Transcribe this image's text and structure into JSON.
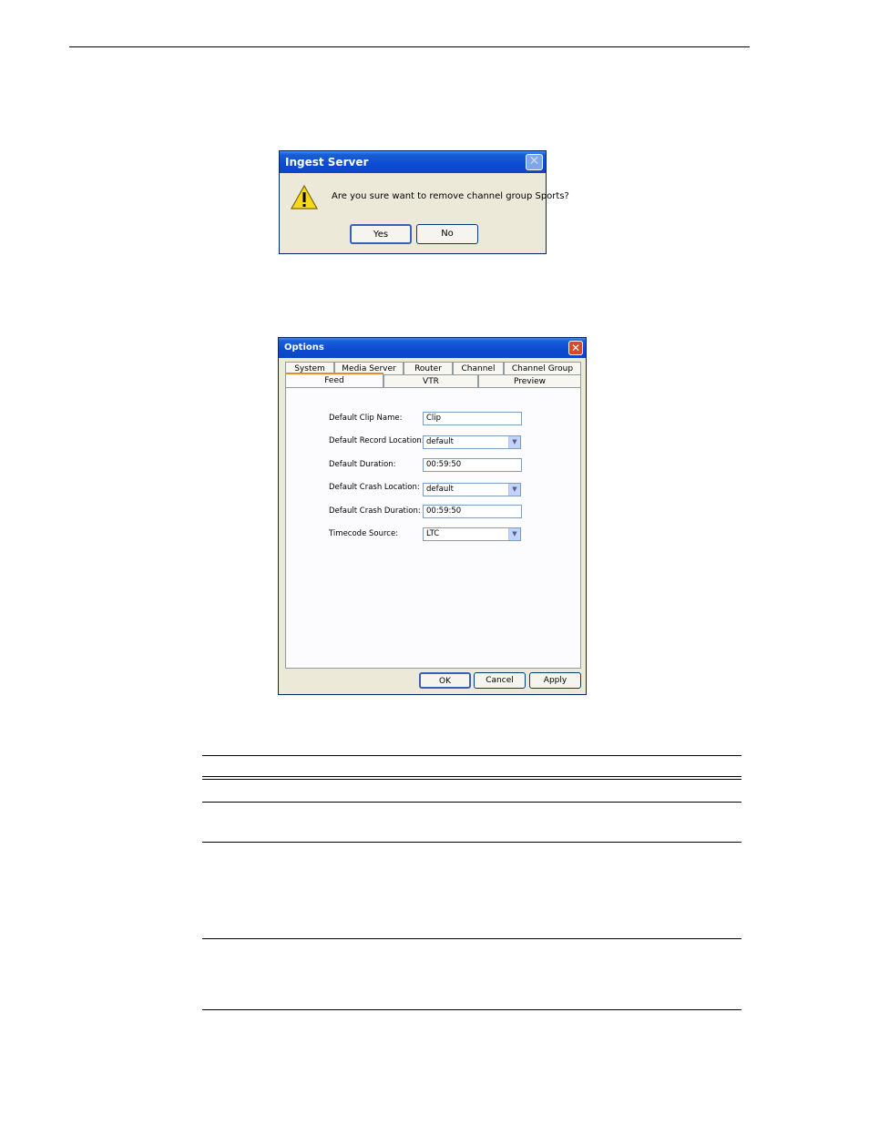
{
  "ingest_dialog": {
    "title": "Ingest Server",
    "message": "Are you sure want to remove channel group Sports?",
    "yes_label": "Yes",
    "no_label": "No",
    "icon": "warning-icon"
  },
  "options_dialog": {
    "title": "Options",
    "tabs_row1": [
      "System",
      "Media Server",
      "Router",
      "Channel",
      "Channel Group"
    ],
    "tabs_row2": [
      "Feed",
      "VTR",
      "Preview"
    ],
    "active_tab": "Feed",
    "fields": {
      "clip_name": {
        "label": "Default Clip Name:",
        "value": "Clip"
      },
      "record_location": {
        "label": "Default Record Location:",
        "value": "default"
      },
      "duration": {
        "label": "Default Duration:",
        "value": "00:59:50"
      },
      "crash_location": {
        "label": "Default Crash Location:",
        "value": "default"
      },
      "crash_duration": {
        "label": "Default Crash Duration:",
        "value": "00:59:50"
      },
      "timecode_source": {
        "label": "Timecode Source:",
        "value": "LTC"
      }
    },
    "ok_label": "OK",
    "cancel_label": "Cancel",
    "apply_label": "Apply"
  },
  "colors": {
    "title_bar": "#0a4bd0",
    "dialog_bg": "#ece9d8",
    "active_tab_accent": "#e68b2c",
    "close_active": "#d9482a"
  }
}
